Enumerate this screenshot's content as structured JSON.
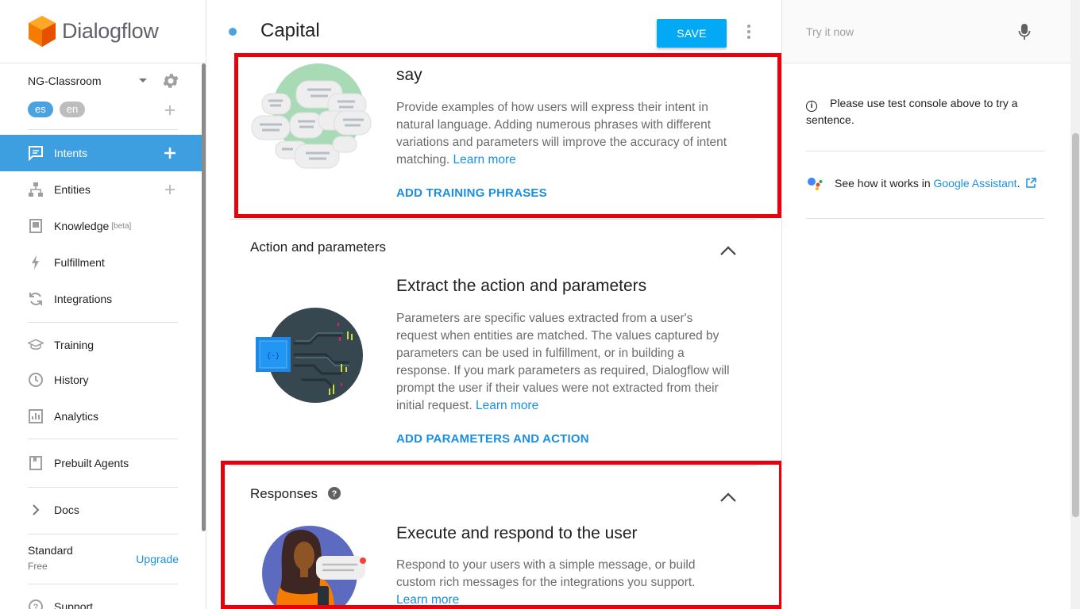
{
  "app": {
    "logo_text": "Dialogflow"
  },
  "agent": {
    "name": "NG-Classroom",
    "languages": [
      "es",
      "en"
    ]
  },
  "sidebar": {
    "items": [
      {
        "label": "Intents",
        "icon": "chat-bubble-icon",
        "active": true
      },
      {
        "label": "Entities",
        "icon": "hierarchy-icon"
      },
      {
        "label": "Knowledge",
        "icon": "book-icon",
        "badge": "[beta]"
      },
      {
        "label": "Fulfillment",
        "icon": "lightning-icon"
      },
      {
        "label": "Integrations",
        "icon": "sync-icon"
      },
      {
        "label": "Training",
        "icon": "graduation-cap-icon"
      },
      {
        "label": "History",
        "icon": "clock-icon"
      },
      {
        "label": "Analytics",
        "icon": "bar-chart-icon"
      },
      {
        "label": "Prebuilt Agents",
        "icon": "bookmark-book-icon"
      },
      {
        "label": "Docs",
        "icon": "chevron-right-icon"
      },
      {
        "label": "Support",
        "icon": "help-circle-icon"
      }
    ],
    "plan": {
      "name": "Standard",
      "tier": "Free",
      "upgrade_label": "Upgrade"
    }
  },
  "main": {
    "intent_name": "Capital",
    "save_label": "SAVE",
    "training": {
      "heading": "say",
      "description": "Provide examples of how users will express their intent in natural language. Adding numerous phrases with different variations and parameters will improve the accuracy of intent matching.",
      "learn_more": "Learn more",
      "action": "ADD TRAINING PHRASES"
    },
    "action_params": {
      "title": "Action and parameters",
      "heading": "Extract the action and parameters",
      "description": "Parameters are specific values extracted from a user's request when entities are matched. The values captured by parameters can be used in fulfillment, or in building a response. If you mark parameters as required, Dialogflow will prompt the user if their values were not extracted from their initial request.",
      "learn_more": "Learn more",
      "action": "ADD PARAMETERS AND ACTION"
    },
    "responses": {
      "title": "Responses",
      "heading": "Execute and respond to the user",
      "description": "Respond to your users with a simple message, or build custom rich messages for the integrations you support.",
      "learn_more": "Learn more"
    }
  },
  "console": {
    "placeholder": "Try it now",
    "info": "Please use test console above to try a sentence.",
    "assistant_prefix": "See how it works in ",
    "assistant_link": "Google Assistant",
    "assistant_suffix": "."
  },
  "colors": {
    "accent": "#03a9f4",
    "sidebar_active": "#3d9fe0",
    "link": "#1a8fe0",
    "highlight_box": "#e8000b",
    "logo_orange": "#f57c00"
  }
}
